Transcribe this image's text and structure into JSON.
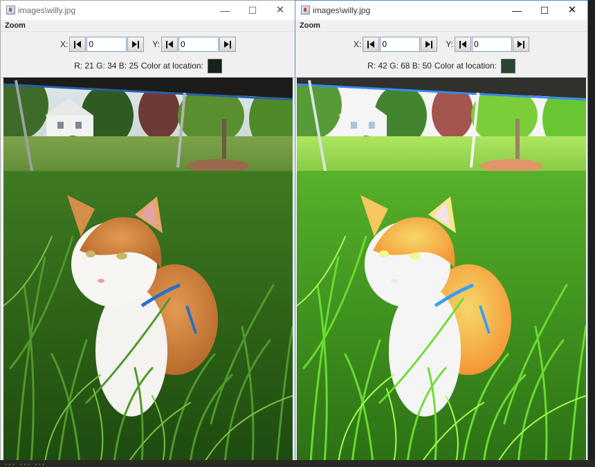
{
  "windows": [
    {
      "title": "images\\willy.jpg",
      "menu": [
        "Zoom"
      ],
      "x_label": "X:",
      "x_value": "0",
      "y_label": "Y:",
      "y_value": "0",
      "rgb_text": "R: 21  G: 34  B: 25",
      "color_label": "Color at location:",
      "swatch_color": "#152219",
      "variant": "original"
    },
    {
      "title": "images\\willy.jpg",
      "menu": [
        "Zoom"
      ],
      "x_label": "X:",
      "x_value": "0",
      "y_label": "Y:",
      "y_value": "0",
      "rgb_text": "R: 42  G: 68  B: 50",
      "color_label": "Color at location:",
      "swatch_color": "#2a4432",
      "variant": "brightened"
    }
  ],
  "window_controls": {
    "minimize": "—",
    "maximize": "☐",
    "close": "✕"
  },
  "colors": {
    "titlebar_active_border": "#4c8fd6",
    "panel_bg": "#f0f0f0"
  },
  "taskbar_snippet": "... ... ..."
}
